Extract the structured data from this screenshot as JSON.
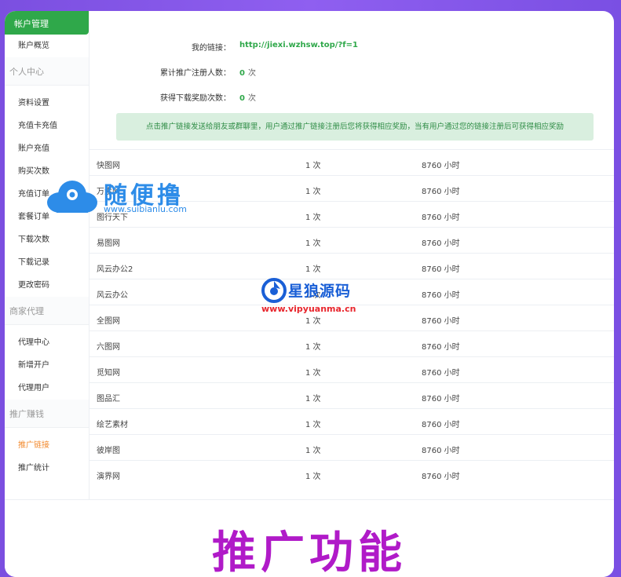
{
  "sidebar": {
    "top_label": "帐户管理",
    "overview": "账户概览",
    "sections": [
      {
        "title": "个人中心",
        "items": [
          "资料设置",
          "充值卡充值",
          "账户充值",
          "购买次数",
          "充值订单",
          "套餐订单",
          "下载次数",
          "下载记录",
          "更改密码"
        ]
      },
      {
        "title": "商家代理",
        "items": [
          "代理中心",
          "新增开户",
          "代理用户"
        ]
      },
      {
        "title": "推广赚钱",
        "items": [
          "推广链接",
          "推广统计"
        ]
      }
    ],
    "active_item": "推广链接"
  },
  "info": {
    "link_label": "我的链接：",
    "link_value": "http://jiexi.wzhsw.top/?f=1",
    "reg_label": "累计推广注册人数：",
    "reg_value": "0",
    "reg_unit": "次",
    "dl_label": "获得下载奖励次数：",
    "dl_value": "0",
    "dl_unit": "次",
    "notice": "点击推广链接发送给朋友或群聊里，用户通过推广链接注册后您将获得相应奖励，当有用户通过您的链接注册后可获得相应奖励"
  },
  "table": {
    "rows": [
      [
        "快图网",
        "1 次",
        "8760 小时"
      ],
      [
        "万素网",
        "1 次",
        "8760 小时"
      ],
      [
        "图行天下",
        "1 次",
        "8760 小时"
      ],
      [
        "易图网",
        "1 次",
        "8760 小时"
      ],
      [
        "风云办公2",
        "1 次",
        "8760 小时"
      ],
      [
        "风云办公",
        "1 次",
        "8760 小时"
      ],
      [
        "全图网",
        "1 次",
        "8760 小时"
      ],
      [
        "六图网",
        "1 次",
        "8760 小时"
      ],
      [
        "觅知网",
        "1 次",
        "8760 小时"
      ],
      [
        "图品汇",
        "1 次",
        "8760 小时"
      ],
      [
        "绘艺素材",
        "1 次",
        "8760 小时"
      ],
      [
        "彼岸图",
        "1 次",
        "8760 小时"
      ],
      [
        "演界网",
        "1 次",
        "8760 小时"
      ]
    ]
  },
  "footer": {
    "title": "推广功能"
  },
  "watermarks": {
    "wm1_name": "随便撸",
    "wm1_url": "www.suibianlu.com",
    "wm2_name": "星狼源码",
    "wm2_url": "www.vipyuanma.cn"
  },
  "colors": {
    "accent_green": "#2fa84a",
    "active_orange": "#f28a2e",
    "promo_purple": "#b01ac8",
    "background_purple": "#8f5ff0"
  }
}
